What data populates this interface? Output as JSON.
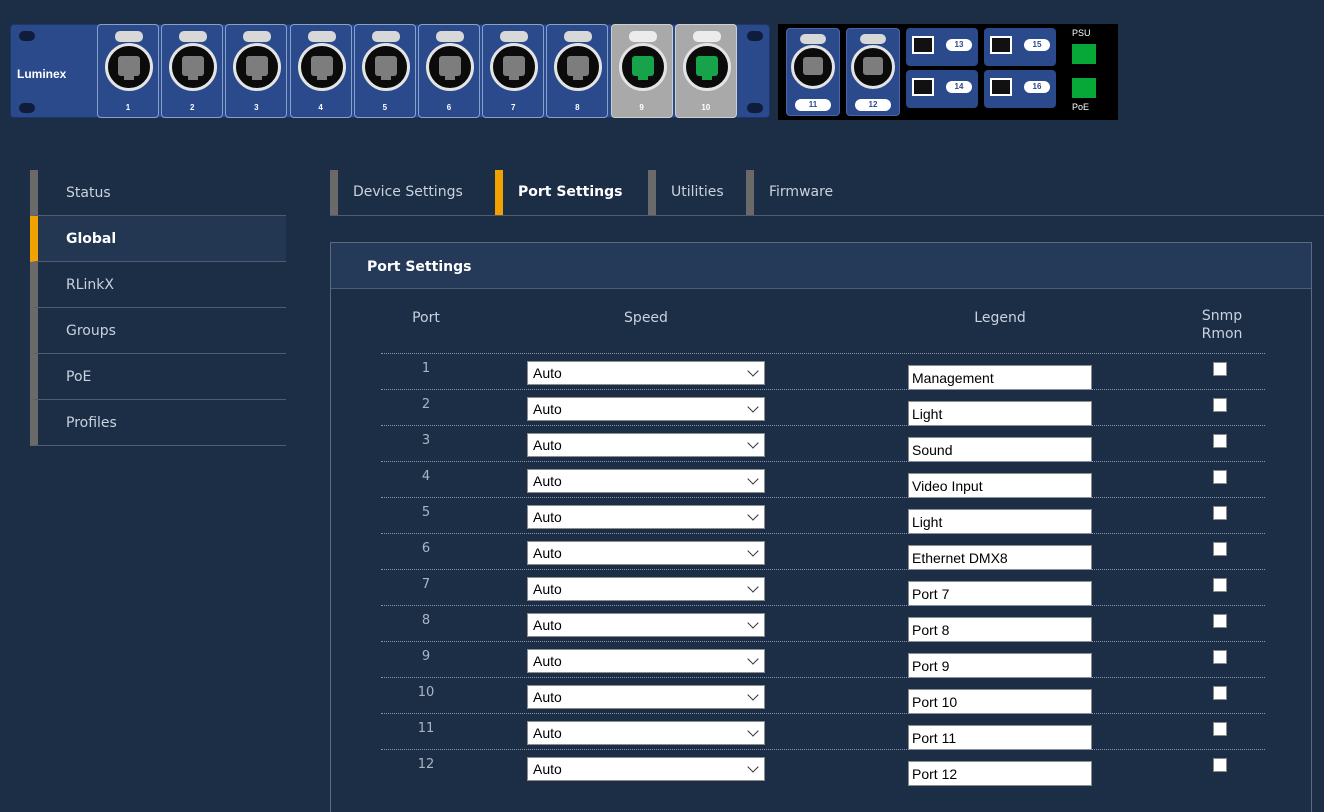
{
  "device": {
    "brand": "Luminex",
    "copper_ports": [
      {
        "label": "1",
        "link": false
      },
      {
        "label": "2",
        "link": false
      },
      {
        "label": "3",
        "link": false
      },
      {
        "label": "4",
        "link": false
      },
      {
        "label": "5",
        "link": false
      },
      {
        "label": "6",
        "link": false
      },
      {
        "label": "7",
        "link": false
      },
      {
        "label": "8",
        "link": false
      },
      {
        "label": "9",
        "link": true
      },
      {
        "label": "10",
        "link": true
      }
    ],
    "module_ports": [
      "11",
      "12"
    ],
    "sfp_slots": [
      "13",
      "14",
      "15",
      "16"
    ],
    "psu_label": "PSU",
    "poe_label": "PoE",
    "colors": {
      "chassis": "#2a4a8c",
      "link_led": "#17a34a",
      "status_led": "#07a838"
    }
  },
  "sidebar": {
    "items": [
      {
        "label": "Status",
        "active": false
      },
      {
        "label": "Global",
        "active": true
      },
      {
        "label": "RLinkX",
        "active": false
      },
      {
        "label": "Groups",
        "active": false
      },
      {
        "label": "PoE",
        "active": false
      },
      {
        "label": "Profiles",
        "active": false
      }
    ]
  },
  "tabs": [
    {
      "label": "Device Settings",
      "active": false
    },
    {
      "label": "Port Settings",
      "active": true
    },
    {
      "label": "Utilities",
      "active": false
    },
    {
      "label": "Firmware",
      "active": false
    }
  ],
  "port_settings": {
    "title": "Port Settings",
    "columns": {
      "port": "Port",
      "speed": "Speed",
      "legend": "Legend",
      "snmp": "Snmp Rmon"
    },
    "rows": [
      {
        "port": "1",
        "speed": "Auto",
        "legend": "Management",
        "snmp": false
      },
      {
        "port": "2",
        "speed": "Auto",
        "legend": "Light",
        "snmp": false
      },
      {
        "port": "3",
        "speed": "Auto",
        "legend": "Sound",
        "snmp": false
      },
      {
        "port": "4",
        "speed": "Auto",
        "legend": "Video Input",
        "snmp": false
      },
      {
        "port": "5",
        "speed": "Auto",
        "legend": "Light",
        "snmp": false
      },
      {
        "port": "6",
        "speed": "Auto",
        "legend": "Ethernet DMX8",
        "snmp": false
      },
      {
        "port": "7",
        "speed": "Auto",
        "legend": "Port 7",
        "snmp": false
      },
      {
        "port": "8",
        "speed": "Auto",
        "legend": "Port 8",
        "snmp": false
      },
      {
        "port": "9",
        "speed": "Auto",
        "legend": "Port 9",
        "snmp": false
      },
      {
        "port": "10",
        "speed": "Auto",
        "legend": "Port 10",
        "snmp": false
      },
      {
        "port": "11",
        "speed": "Auto",
        "legend": "Port 11",
        "snmp": false
      },
      {
        "port": "12",
        "speed": "Auto",
        "legend": "Port 12",
        "snmp": false
      }
    ]
  },
  "accent_color": "#f2a200"
}
